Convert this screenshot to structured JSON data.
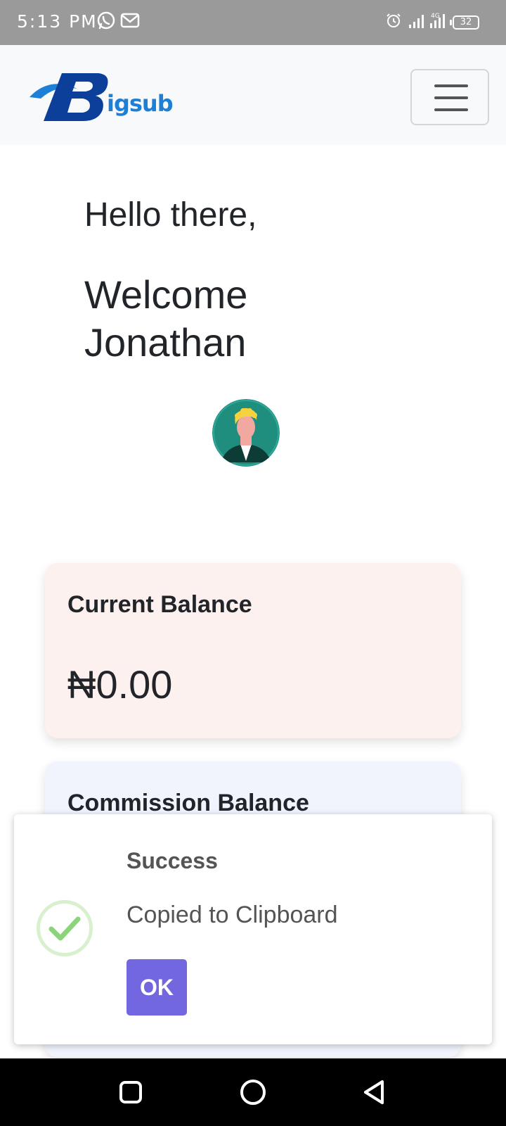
{
  "status_bar": {
    "time": "5:13 PM",
    "network": "4G",
    "battery": "32"
  },
  "navbar": {
    "brand_text": "igsub",
    "brand_color": "#1e7fd6"
  },
  "greeting": {
    "hello": "Hello there,",
    "welcome_line1": "Welcome",
    "welcome_line2": "Jonathan"
  },
  "cards": {
    "current_balance_label": "Current Balance",
    "current_balance_value": "₦0.00",
    "commission_balance_label": "Commission Balance"
  },
  "alert": {
    "title": "Success",
    "message": "Copied to Clipboard",
    "ok_label": "OK",
    "accent_color": "#7367e0",
    "success_color": "#8cd47a"
  },
  "icons": {
    "whatsapp": "whatsapp-icon",
    "gmail": "gmail-icon",
    "alarm": "alarm-icon",
    "signal": "signal-icon",
    "menu": "hamburger-menu-icon",
    "check": "check-icon",
    "back": "back-icon",
    "home": "home-icon",
    "recents": "recents-icon"
  }
}
